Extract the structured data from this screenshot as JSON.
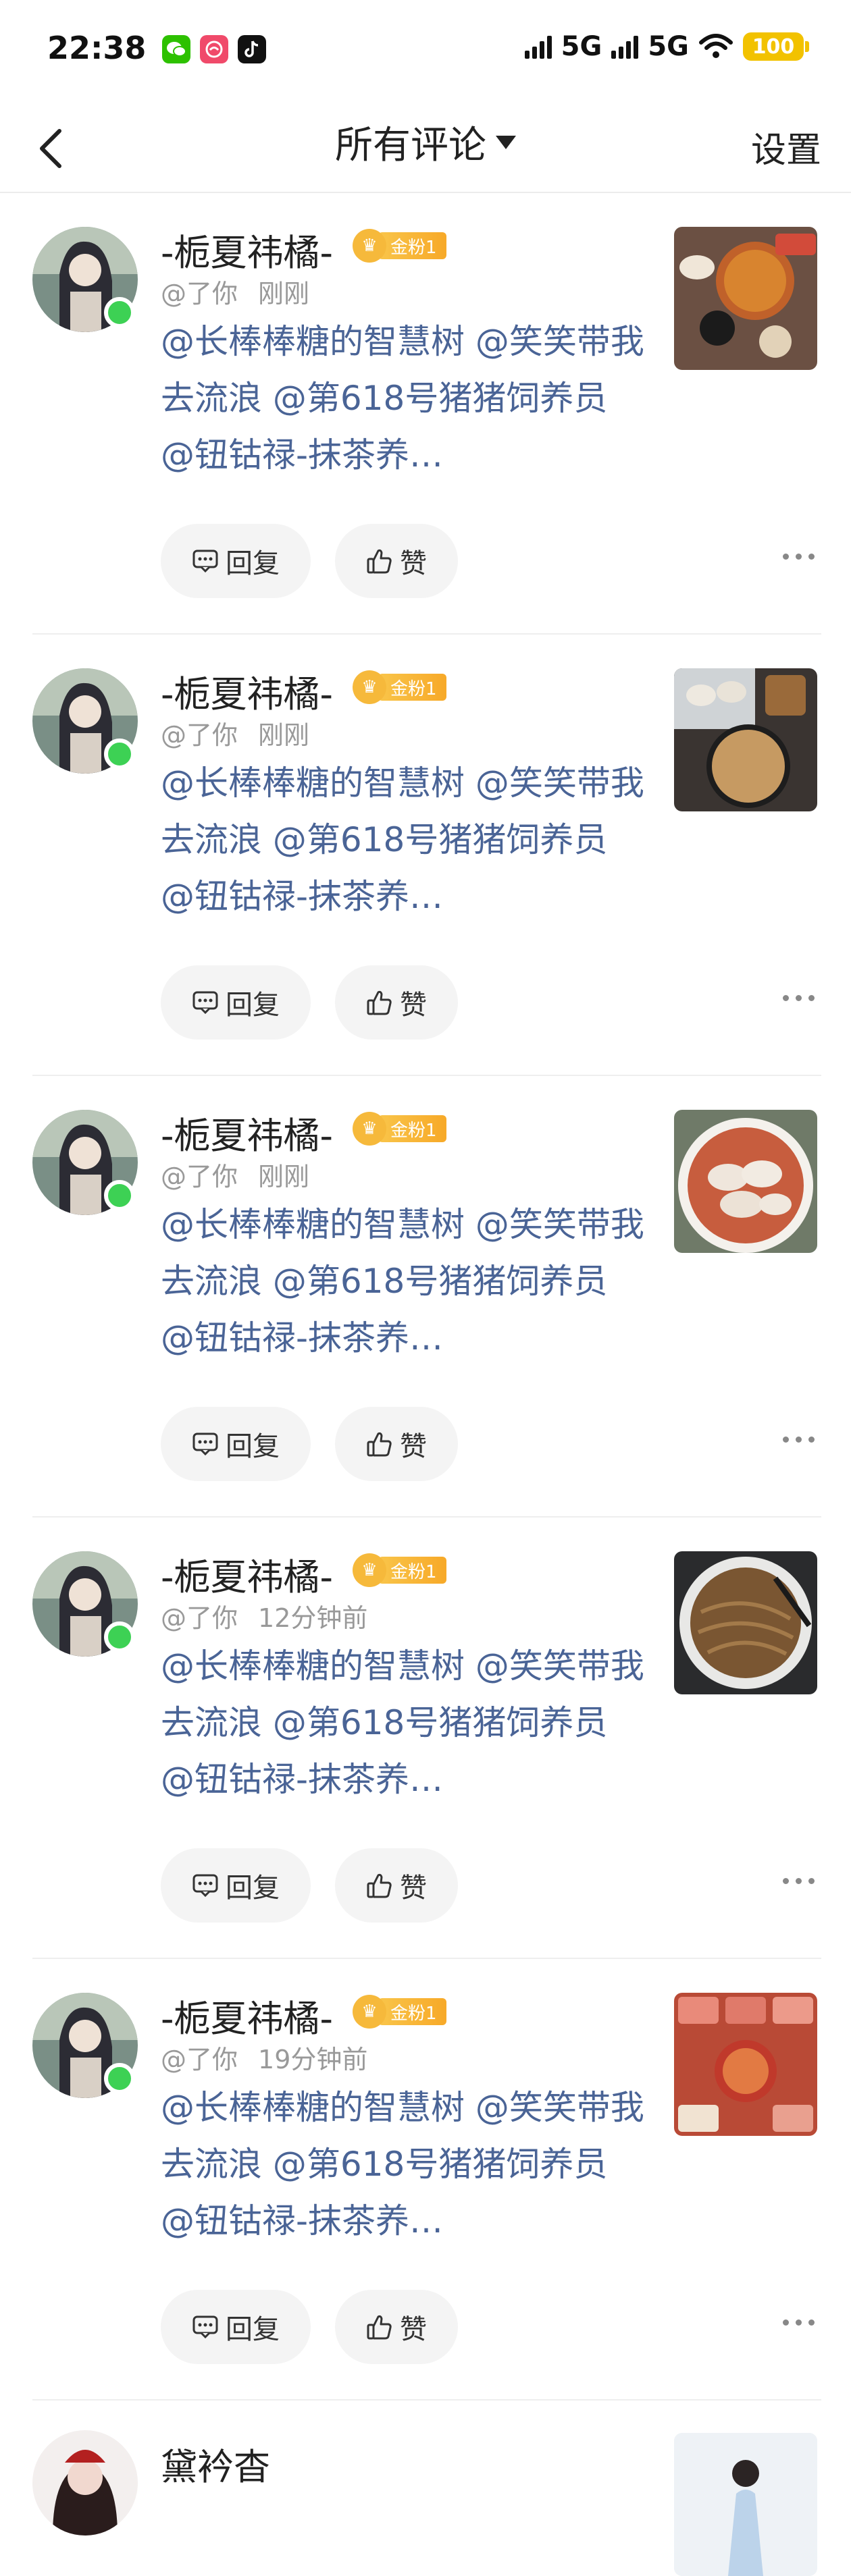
{
  "status_bar": {
    "time": "22:38",
    "network1": "5G",
    "network2": "5G",
    "battery": "100",
    "app_icons": [
      "wechat-icon",
      "app-red-icon",
      "tiktok-icon"
    ]
  },
  "header": {
    "title": "所有评论",
    "settings_label": "设置"
  },
  "comments": [
    {
      "username": "-栀夏祎橘-",
      "badge": "金粉1",
      "mention_me": "@了你",
      "time": "刚刚",
      "text": "@长棒棒糖的智慧树 @笑笑带我去流浪 @第618号猪猪饲养员 @钮钴禄-抹茶养…",
      "reply_label": "回复",
      "like_label": "赞",
      "thumb": "hotpot"
    },
    {
      "username": "-栀夏祎橘-",
      "badge": "金粉1",
      "mention_me": "@了你",
      "time": "刚刚",
      "text": "@长棒棒糖的智慧树 @笑笑带我去流浪 @第618号猪猪饲养员 @钮钴禄-抹茶养…",
      "reply_label": "回复",
      "like_label": "赞",
      "thumb": "dumplings-pan"
    },
    {
      "username": "-栀夏祎橘-",
      "badge": "金粉1",
      "mention_me": "@了你",
      "time": "刚刚",
      "text": "@长棒棒糖的智慧树 @笑笑带我去流浪 @第618号猪猪饲养员 @钮钴禄-抹茶养…",
      "reply_label": "回复",
      "like_label": "赞",
      "thumb": "wonton-soup"
    },
    {
      "username": "-栀夏祎橘-",
      "badge": "金粉1",
      "mention_me": "@了你",
      "time": "12分钟前",
      "text": "@长棒棒糖的智慧树 @笑笑带我去流浪 @第618号猪猪饲养员 @钮钴禄-抹茶养…",
      "reply_label": "回复",
      "like_label": "赞",
      "thumb": "noodles"
    },
    {
      "username": "-栀夏祎橘-",
      "badge": "金粉1",
      "mention_me": "@了你",
      "time": "19分钟前",
      "text": "@长棒棒糖的智慧树 @笑笑带我去流浪 @第618号猪猪饲养员 @钮钴禄-抹茶养…",
      "reply_label": "回复",
      "like_label": "赞",
      "thumb": "bbq-spread"
    }
  ],
  "partial_comment": {
    "username": "黛衿杳"
  },
  "colors": {
    "mention_text": "#4a6496",
    "online_dot": "#3dd154",
    "badge": "#f7a928",
    "battery": "#f2c200"
  }
}
